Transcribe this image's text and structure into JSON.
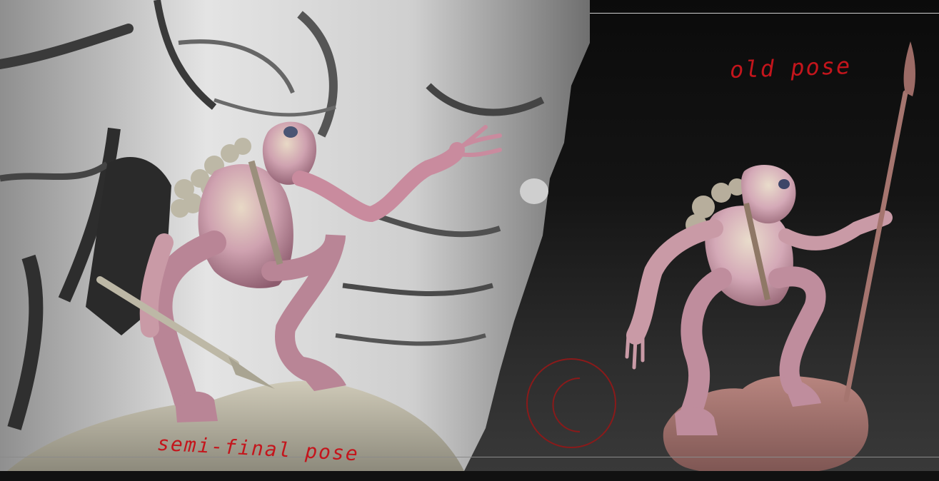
{
  "labels": {
    "old_pose": "old pose",
    "semi_final_pose": "semi-final pose"
  },
  "colors": {
    "annotation": "#c4151c",
    "rock": "#d9d9d9",
    "creature_skin": "#c99aa6",
    "base_rock": "#9b6e6c",
    "background_dark": "#0b0b0b"
  }
}
